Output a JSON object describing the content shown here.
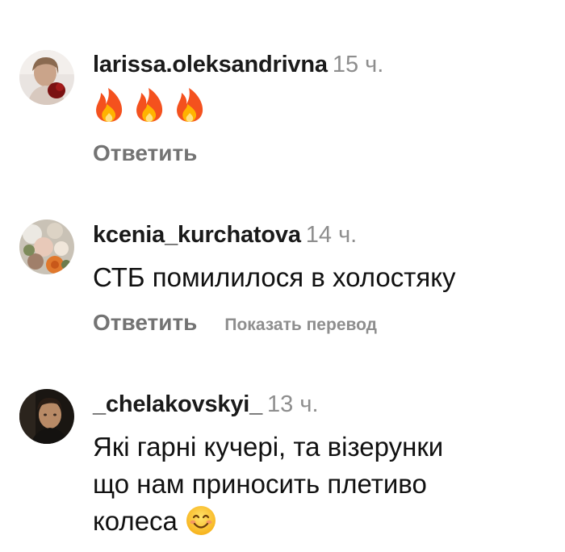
{
  "comments": [
    {
      "username": "larissa.oleksandrivna",
      "time": "15 ч.",
      "text": "🔥🔥🔥",
      "reply_label": "Ответить"
    },
    {
      "username": "kcenia_kurchatova",
      "time": "14 ч.",
      "text": "СТБ помилилося в холостяку",
      "reply_label": "Ответить",
      "translate_label": "Показать перевод"
    },
    {
      "username": "_chelakovskyi_",
      "time": "13 ч.",
      "text_lines": [
        "Які гарні кучері, та візерунки",
        "що нам приносить плетиво",
        "колеса"
      ],
      "trailing_emoji": "smiling-face-icon"
    }
  ],
  "colors": {
    "username": "#1a1a1a",
    "time": "#8e8e8e",
    "reply": "#737373",
    "text": "#111111"
  }
}
